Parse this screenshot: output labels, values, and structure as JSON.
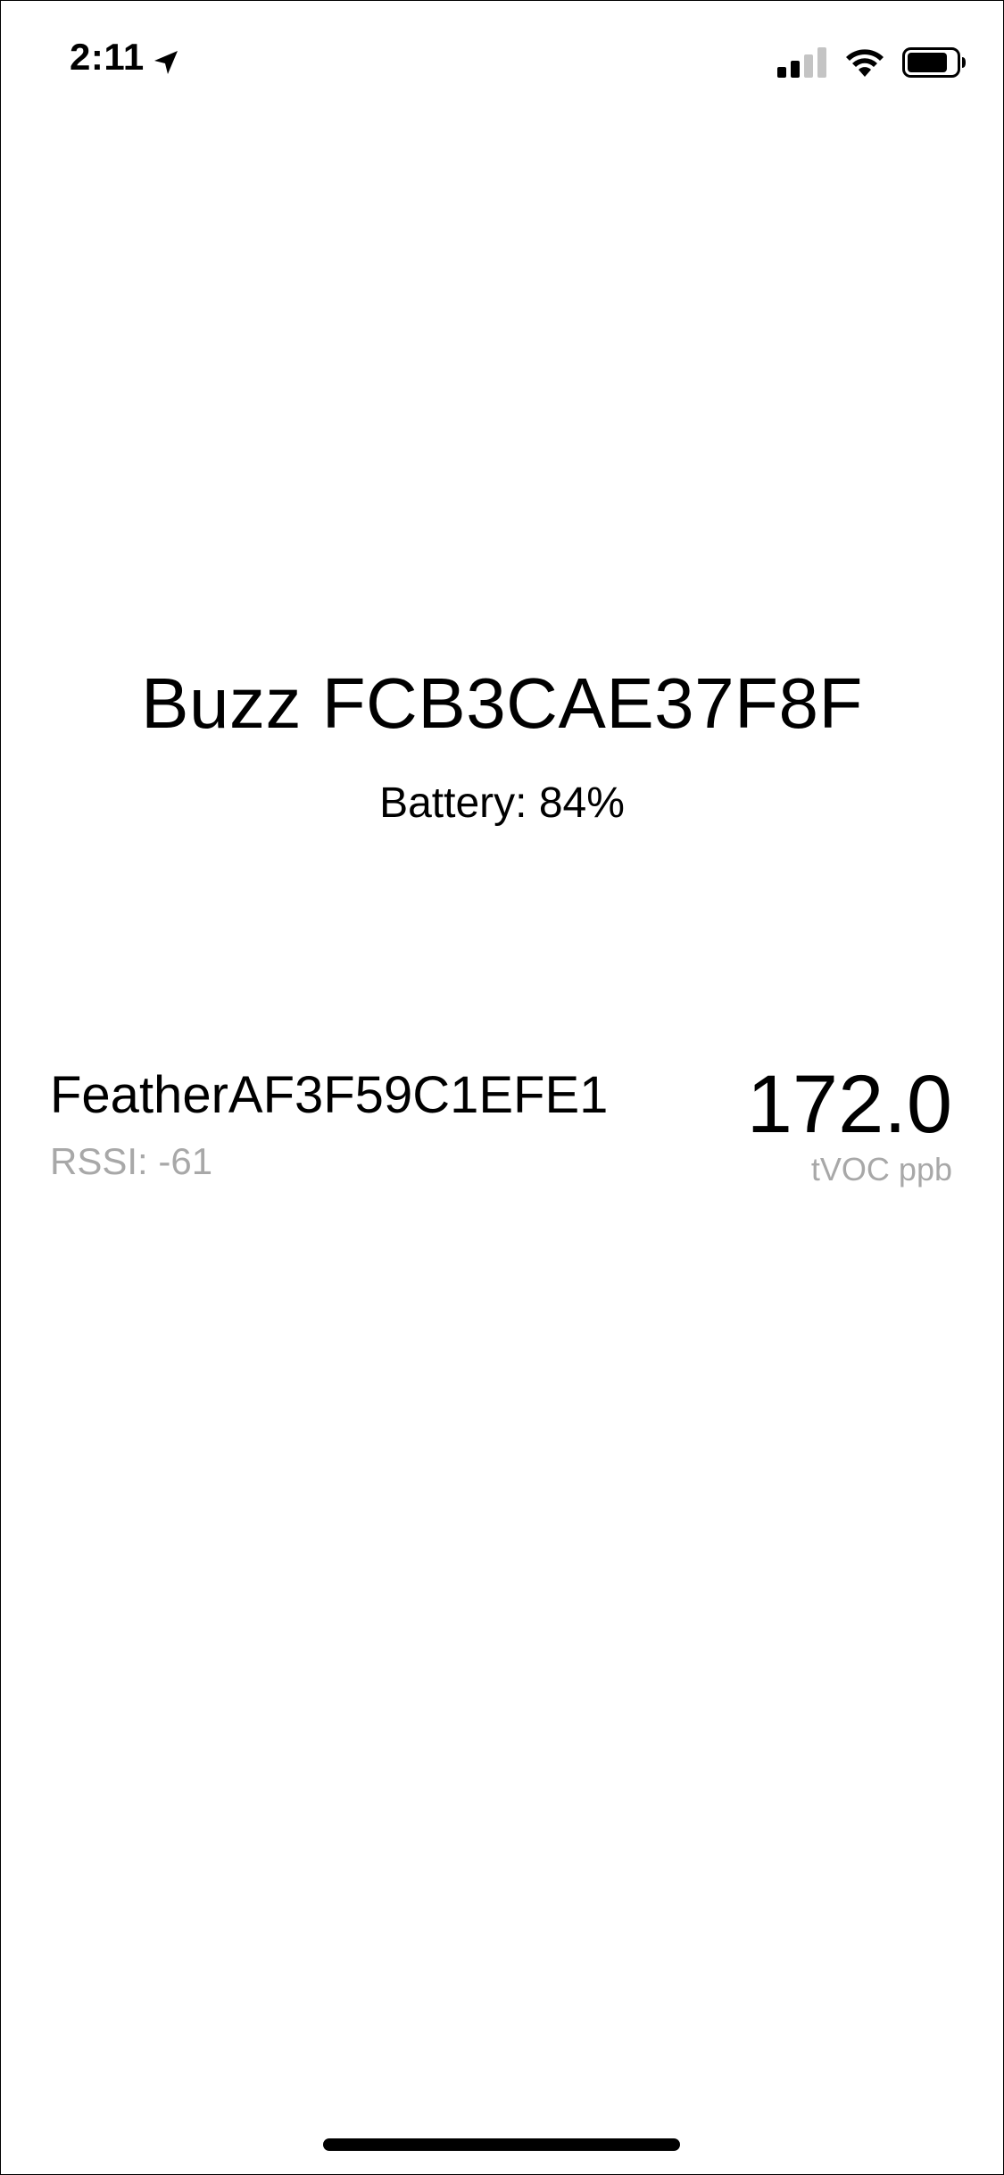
{
  "status_bar": {
    "time": "2:11",
    "icons": [
      "location-arrow-icon",
      "cellular-signal-icon",
      "wifi-icon",
      "battery-icon"
    ]
  },
  "device": {
    "title": "Buzz FCB3CAE37F8F",
    "battery": "Battery: 84%"
  },
  "sensors": [
    {
      "name": "FeatherAF3F59C1EFE1",
      "rssi": "RSSI: -61",
      "value": "172.0",
      "unit": "tVOC ppb"
    }
  ],
  "colors": {
    "text": "#000000",
    "secondary_text": "#a8a8a8",
    "background": "#ffffff"
  }
}
